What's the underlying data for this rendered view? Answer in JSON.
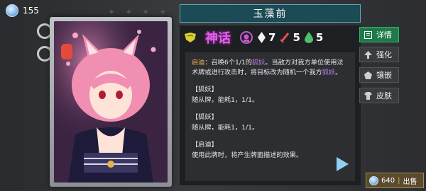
{
  "currency": {
    "value": "155"
  },
  "card": {
    "title": "玉藻前",
    "rarity": "神话",
    "stats": {
      "cost": "7",
      "attack": "5",
      "health": "5"
    },
    "description": {
      "prefix": "启迪",
      "text1": "：召唤6个1/1的",
      "link1": "狐妖",
      "text2": "。当敌方对我方单位使用法术牌或进行攻击时，将目标改为随机一个我方",
      "link2": "狐妖",
      "text3": "。",
      "block1_head": "【狐妖】",
      "block1_body": "随从牌，能耗1，1/1。",
      "block2_head": "【狐妖】",
      "block2_body": "随从牌，能耗1，1/1。",
      "block3_head": "【启迪】",
      "block3_body": "使用此牌时，将产生牌面描述的效果。"
    }
  },
  "buttons": {
    "detail": "详情",
    "strengthen": "强化",
    "inlay": "镶嵌",
    "skin": "皮肤"
  },
  "sell": {
    "value": "640",
    "label": "出售"
  },
  "colors": {
    "accent_green": "#1f7a4a",
    "title_teal": "#1c4a55",
    "rarity_purple": "#e25fe6",
    "highlight": "#e8b24c"
  }
}
